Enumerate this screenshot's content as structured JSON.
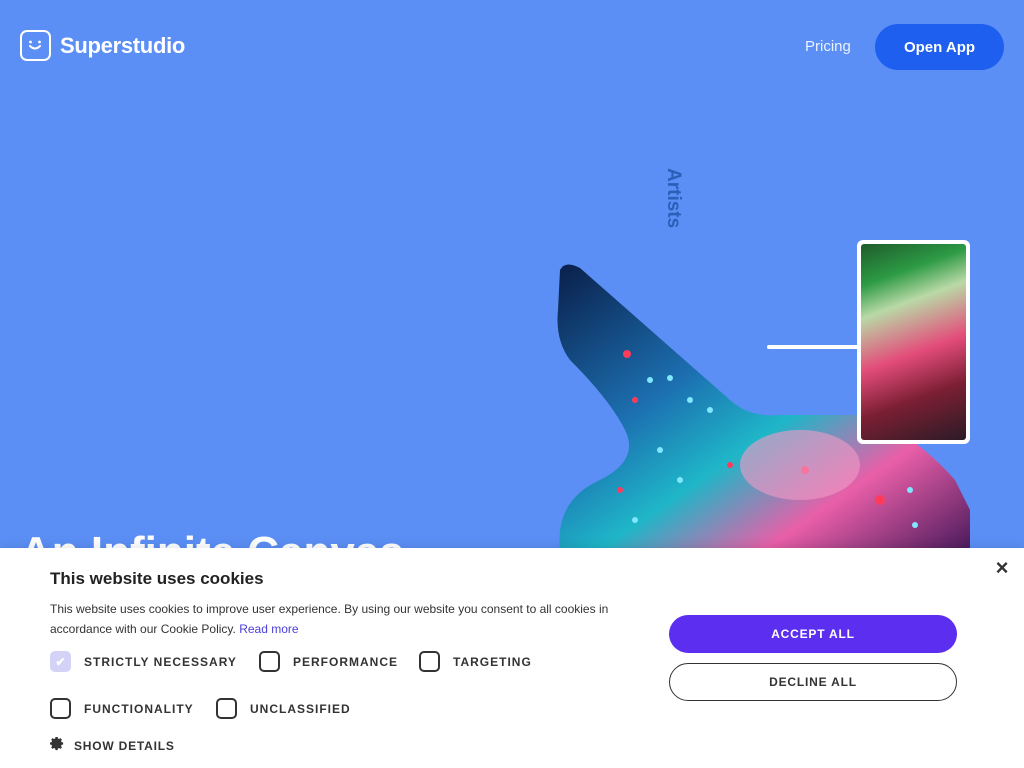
{
  "header": {
    "brand": "Superstudio",
    "nav_pricing": "Pricing",
    "open_app": "Open App"
  },
  "hero": {
    "vertical_label": "Artists",
    "title": "An Infinite Canvas"
  },
  "cookie_banner": {
    "title": "This website uses cookies",
    "body": "This website uses cookies to improve user experience. By using our website you consent to all cookies in accordance with our Cookie Policy.",
    "read_more": "Read more",
    "options": [
      {
        "label": "STRICTLY NECESSARY",
        "checked": true
      },
      {
        "label": "PERFORMANCE",
        "checked": false
      },
      {
        "label": "TARGETING",
        "checked": false
      },
      {
        "label": "FUNCTIONALITY",
        "checked": false
      },
      {
        "label": "UNCLASSIFIED",
        "checked": false
      }
    ],
    "show_details": "SHOW DETAILS",
    "accept_all": "ACCEPT ALL",
    "decline_all": "DECLINE ALL",
    "close_icon": "close-icon",
    "details_icon": "gear-icon"
  },
  "colors": {
    "background": "#5b8ff5",
    "primary_button": "#1e5ff0",
    "accept_button": "#5b2ef0",
    "read_more_link": "#4a3fd8"
  }
}
